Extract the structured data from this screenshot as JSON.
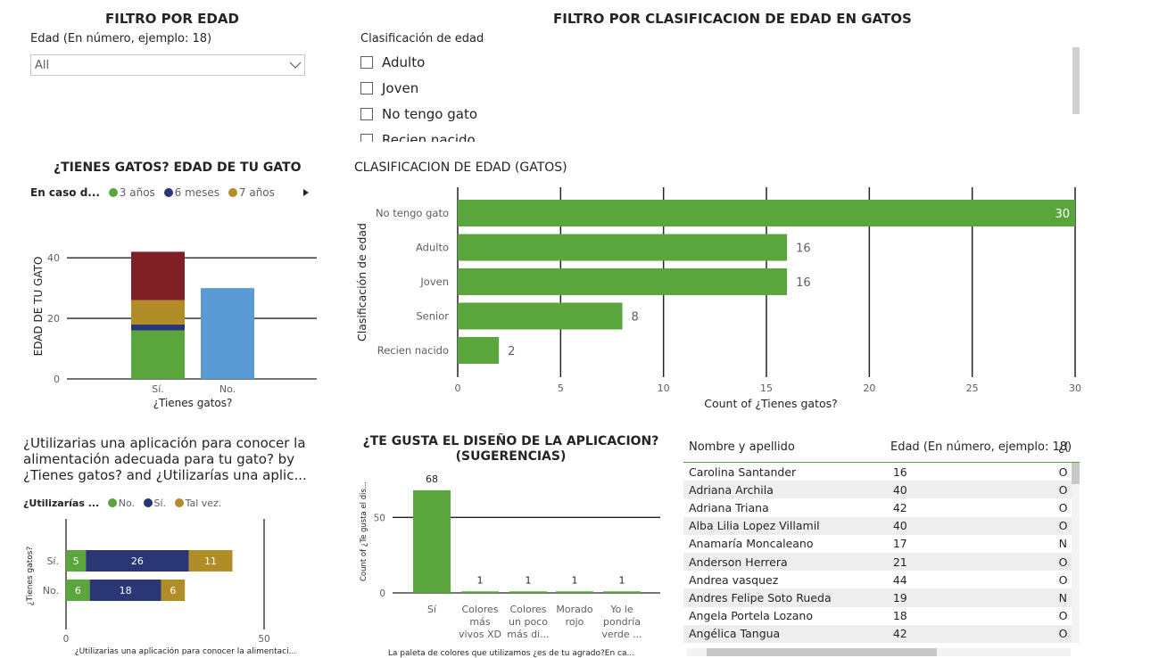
{
  "filter_edad": {
    "title": "FILTRO POR EDAD",
    "label": "Edad (En número, ejemplo: 18)",
    "value": "All"
  },
  "filter_clasif": {
    "title": "FILTRO POR CLASIFICACION DE EDAD EN GATOS",
    "label": "Clasificación de edad",
    "options": [
      "Adulto",
      "Joven",
      "No tengo gato",
      "Recien nacido"
    ]
  },
  "chart1": {
    "title": "¿TIENES GATOS? EDAD DE TU GATO",
    "legend_label": "En caso d...",
    "legend": [
      {
        "name": "3 años",
        "color": "#5aa63c"
      },
      {
        "name": "6 meses",
        "color": "#2b3674"
      },
      {
        "name": "7 años",
        "color": "#b08d26"
      }
    ],
    "xlabel": "¿Tienes gatos?",
    "ylabel": "EDAD DE TU GATO"
  },
  "chart2": {
    "title": "CLASIFICACION DE EDAD (GATOS)",
    "xlabel": "Count of ¿Tienes gatos?",
    "ylabel": "Clasificación de edad"
  },
  "chart3": {
    "title_lines": [
      "¿Utilizarias una aplicación para conocer la",
      "alimentación adecuada para tu gato? by",
      "¿Tienes gatos? and ¿Utilizarías una aplic..."
    ],
    "legend_label": "¿Utilizarías ...",
    "legend": [
      {
        "name": "No.",
        "color": "#5aa63c"
      },
      {
        "name": "Sí.",
        "color": "#2b3674"
      },
      {
        "name": "Tal vez.",
        "color": "#b08d26"
      }
    ],
    "xlabel": "¿Utilizarias una aplicación para conocer la alimentaci...",
    "ylabel": "¿Tienes gatos?"
  },
  "chart4": {
    "title_lines": [
      "¿TE GUSTA EL DISEÑO DE LA APLICACION?",
      "(SUGERENCIAS)"
    ],
    "xlabel": "La paleta de colores que utilizamos ¿es de tu agrado?En ca...",
    "ylabel": "Count of ¿Te gusta el dis..."
  },
  "chart_data": [
    {
      "type": "bar",
      "stacked": true,
      "title": "¿TIENES GATOS? EDAD DE TU GATO",
      "categories": [
        "Sí.",
        "No."
      ],
      "series": [
        {
          "name": "3 años",
          "color": "#5aa63c",
          "values": [
            16,
            0
          ]
        },
        {
          "name": "6 meses",
          "color": "#2b3674",
          "values": [
            2,
            0
          ]
        },
        {
          "name": "7 años",
          "color": "#b08d26",
          "values": [
            8,
            0
          ]
        },
        {
          "color": "#7f1f26",
          "values": [
            16,
            0
          ]
        },
        {
          "color": "#5b9bd5",
          "values": [
            0,
            30
          ]
        }
      ],
      "yticks": [
        0,
        20,
        40
      ],
      "ylim": [
        0,
        48
      ],
      "xlabel": "¿Tienes gatos?",
      "ylabel": "EDAD DE TU GATO"
    },
    {
      "type": "bar",
      "orientation": "horizontal",
      "title": "CLASIFICACION DE EDAD (GATOS)",
      "categories": [
        "No tengo gato",
        "Adulto",
        "Joven",
        "Senior",
        "Recien nacido"
      ],
      "values": [
        30,
        16,
        16,
        8,
        2
      ],
      "color": "#5aa63c",
      "xticks": [
        0,
        5,
        10,
        15,
        20,
        25,
        30
      ],
      "xlim": [
        0,
        30
      ],
      "xlabel": "Count of ¿Tienes gatos?",
      "ylabel": "Clasificación de edad"
    },
    {
      "type": "bar",
      "orientation": "horizontal",
      "stacked": true,
      "categories": [
        "Sí.",
        "No."
      ],
      "series": [
        {
          "name": "No.",
          "color": "#5aa63c",
          "values": [
            5,
            6
          ]
        },
        {
          "name": "Sí.",
          "color": "#2b3674",
          "values": [
            26,
            18
          ]
        },
        {
          "name": "Tal vez.",
          "color": "#b08d26",
          "values": [
            11,
            6
          ]
        }
      ],
      "xticks": [
        0,
        50
      ],
      "xlim": [
        0,
        50
      ],
      "xlabel": "¿Utilizarias una aplicación para conocer la alimentaci...",
      "ylabel": "¿Tienes gatos?"
    },
    {
      "type": "bar",
      "title": "¿TE GUSTA EL DISEÑO DE LA APLICACION? (SUGERENCIAS)",
      "categories": [
        [
          "Sí"
        ],
        [
          "Colores",
          "más",
          "vivos XD"
        ],
        [
          "Colores",
          "un poco",
          "más di..."
        ],
        [
          "Morado",
          "rojo"
        ],
        [
          "Yo le",
          "pondría",
          "verde ..."
        ]
      ],
      "values": [
        68,
        1,
        1,
        1,
        1
      ],
      "color": "#5aa63c",
      "yticks": [
        0,
        50
      ],
      "ylim": [
        0,
        75
      ],
      "xlabel": "La paleta de colores que utilizamos ¿es de tu agrado?En ca...",
      "ylabel": "Count of ¿Te gusta el dis..."
    }
  ],
  "table": {
    "headers": [
      "Nombre y apellido",
      "Edad (En número, ejemplo: 18)",
      "¿("
    ],
    "rows": [
      [
        "Carolina Santander",
        "16",
        "O"
      ],
      [
        "Adriana Archila",
        "40",
        "O"
      ],
      [
        "Adriana Triana",
        "42",
        "O"
      ],
      [
        "Alba Lilia Lopez Villamil",
        "40",
        "O"
      ],
      [
        "Anamaría Moncaleano",
        "17",
        "N"
      ],
      [
        "Anderson Herrera",
        "21",
        "O"
      ],
      [
        "Andrea vasquez",
        "44",
        "O"
      ],
      [
        "Andres Felipe Soto Rueda",
        "19",
        "N"
      ],
      [
        "Angela Portela Lozano",
        "18",
        "O"
      ],
      [
        "Angélica Tangua",
        "42",
        "O"
      ]
    ]
  },
  "colors": {
    "green": "#5aa63c",
    "navy": "#2b3674",
    "gold": "#b08d26",
    "maroon": "#7f1f26",
    "blue": "#5b9bd5"
  }
}
